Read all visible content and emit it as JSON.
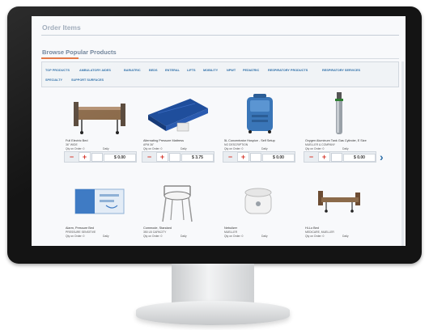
{
  "page": {
    "order_title": "Order Items",
    "browse_title": "Browse Popular Products"
  },
  "tabs": [
    {
      "label": "Top Products"
    },
    {
      "label": "Ambulatory Aides"
    },
    {
      "label": "Bariatric"
    },
    {
      "label": "Beds"
    },
    {
      "label": "Enteral"
    },
    {
      "label": "Lifts"
    },
    {
      "label": "Mobility"
    },
    {
      "label": "NPWT"
    },
    {
      "label": "Pediatric"
    },
    {
      "label": "Respiratory Products"
    },
    {
      "label": "Respiratory Services"
    },
    {
      "label": "Specialty"
    },
    {
      "label": "Support Surfaces"
    }
  ],
  "products": [
    {
      "name": "Full Electric Bed",
      "sub": "36\" wide",
      "qty_label": "Qty on Order: 0",
      "unit": "Daily",
      "price": "$ 0.00",
      "icon": "hospital-bed"
    },
    {
      "name": "Alternating Pressure Mattress",
      "sub": "APM 36\"",
      "qty_label": "Qty on Order: 0",
      "unit": "Daily",
      "price": "$ 3.75",
      "icon": "pressure-mattress"
    },
    {
      "name": "5L Concentrator Hospice - Self Setup",
      "sub": "no description",
      "qty_label": "Qty on Order: 0",
      "unit": "Daily",
      "price": "$ 0.00",
      "icon": "oxygen-concentrator"
    },
    {
      "name": "Oxygen Aluminum Tank Gas Cylinder, E Size",
      "sub": "Mueller & Company",
      "qty_label": "Qty on Order: 0",
      "unit": "Daily",
      "price": "$ 0.00",
      "icon": "oxygen-cylinder"
    },
    {
      "name": "Alarm, Pressure Bed",
      "sub": "Pressure Sensitive",
      "qty_label": "Qty on Order: 0",
      "unit": "Daily",
      "icon": "bed-alarm"
    },
    {
      "name": "Commode, Standard",
      "sub": "350 lb capacity",
      "qty_label": "Qty on Order: 0",
      "unit": "Daily",
      "icon": "commode"
    },
    {
      "name": "Nebulizer",
      "sub": "Mueller",
      "qty_label": "Qty on Order: 0",
      "unit": "Daily",
      "icon": "nebulizer"
    },
    {
      "name": "Hi-Lo Bed",
      "sub": "Medicare, Mueller",
      "qty_label": "Qty on Order: 0",
      "unit": "Daily",
      "icon": "hi-lo-bed"
    }
  ]
}
